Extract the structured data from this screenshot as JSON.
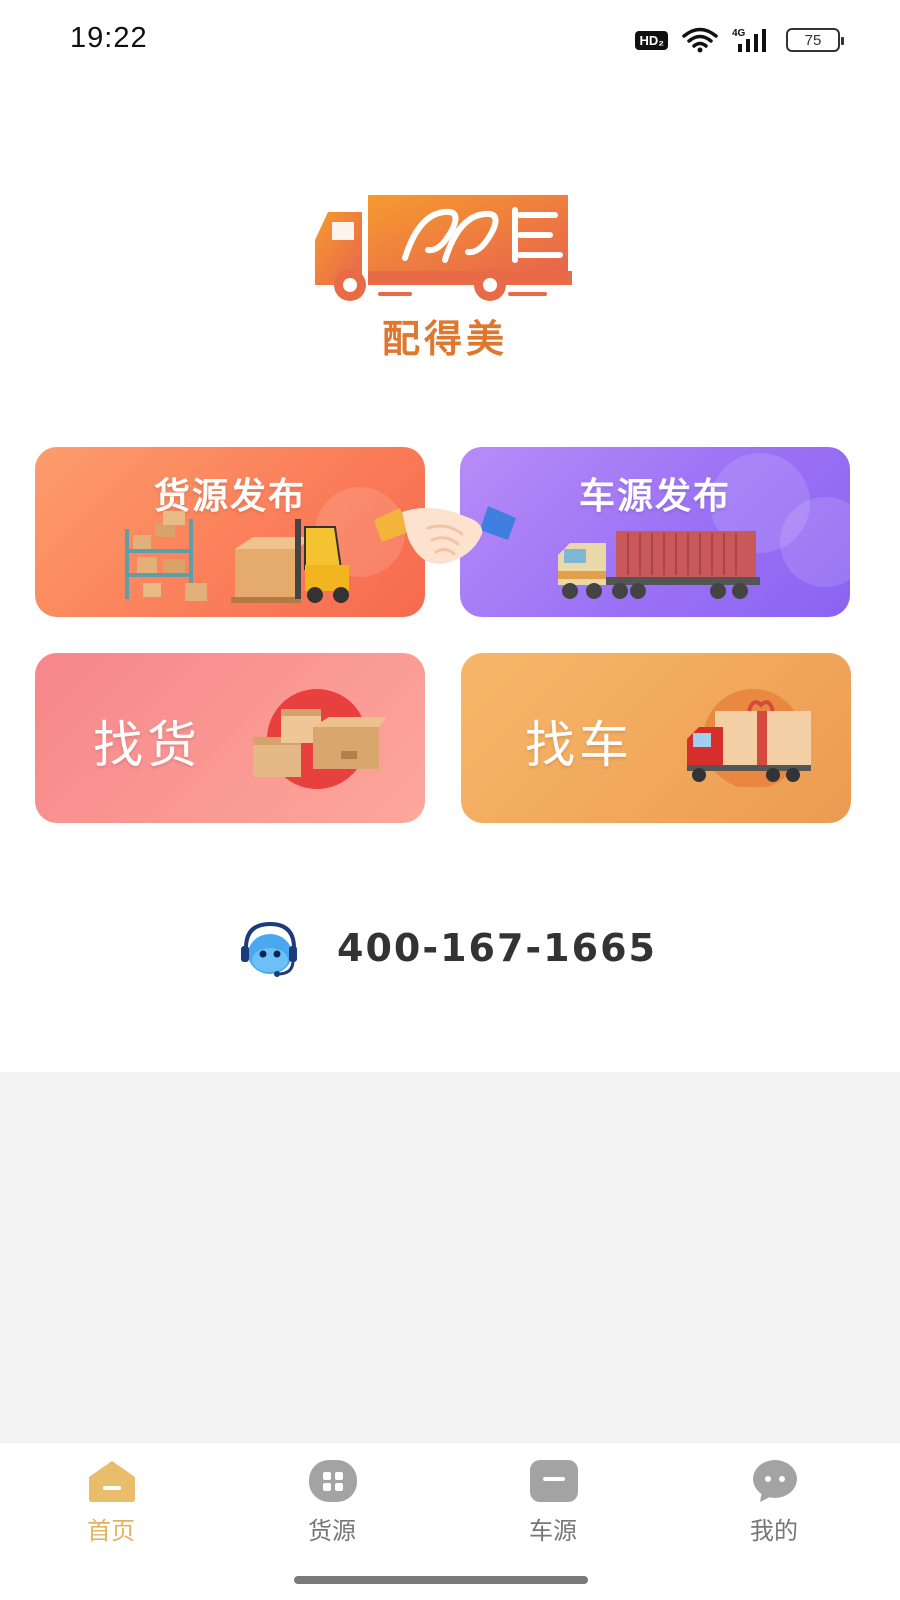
{
  "status_bar": {
    "time": "19:22",
    "hd_label": "HD₂",
    "network_label": "4G",
    "battery_level": "75",
    "icons": [
      "hd-voice-icon",
      "wifi-icon",
      "signal-4g-icon",
      "battery-icon"
    ]
  },
  "logo": {
    "brand_name": "配得美",
    "icon": "delivery-truck-logo",
    "colors": {
      "primary": "#f07a2e",
      "secondary": "#e96854"
    }
  },
  "cards": {
    "cargo_publish": {
      "label": "货源发布",
      "icon": "warehouse-forklift-illustration"
    },
    "truck_publish": {
      "label": "车源发布",
      "icon": "container-truck-illustration"
    },
    "find_cargo": {
      "label": "找货",
      "icon": "cardboard-boxes-illustration"
    },
    "find_truck": {
      "label": "找车",
      "icon": "red-truck-with-box-illustration"
    },
    "handshake_icon": "handshake-illustration"
  },
  "hotline": {
    "number": "400-167-1665",
    "icon": "customer-service-headset-icon"
  },
  "tab_bar": {
    "active_color": "#e3b25e",
    "inactive_color": "#9a9a9a",
    "items": [
      {
        "label": "首页",
        "icon": "home-icon",
        "active": true
      },
      {
        "label": "货源",
        "icon": "cargo-source-icon",
        "active": false
      },
      {
        "label": "车源",
        "icon": "vehicle-source-icon",
        "active": false
      },
      {
        "label": "我的",
        "icon": "profile-icon",
        "active": false
      }
    ]
  }
}
